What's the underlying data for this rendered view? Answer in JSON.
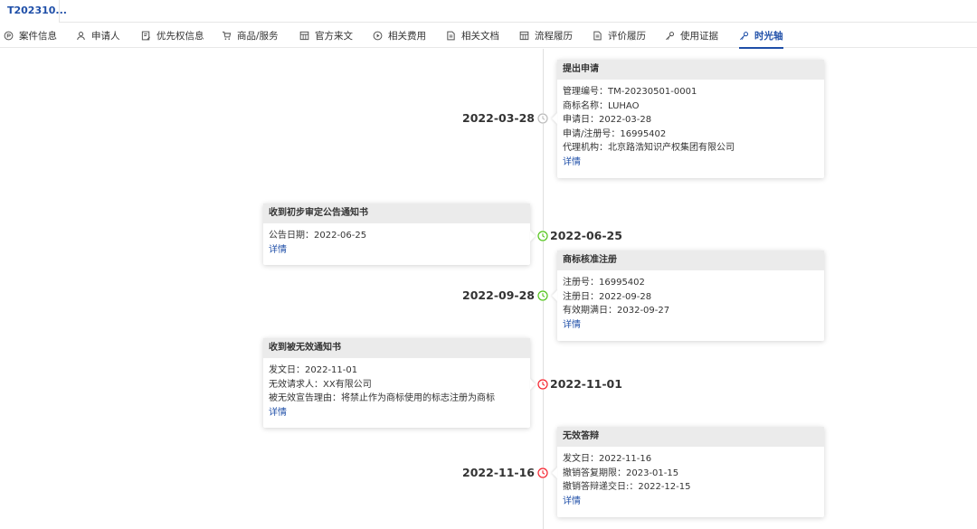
{
  "document_tab": "T202310...",
  "colors": {
    "accent": "#1f4fa8",
    "node_gray": "#bbbbbb",
    "node_green": "#52c41a",
    "node_red": "#f5222d"
  },
  "tabs": [
    {
      "label": "案件信息",
      "icon": "info-circle-icon"
    },
    {
      "label": "申请人",
      "icon": "user-icon"
    },
    {
      "label": "优先权信息",
      "icon": "document-edit-icon"
    },
    {
      "label": "商品/服务",
      "icon": "cart-icon"
    },
    {
      "label": "官方来文",
      "icon": "table-icon"
    },
    {
      "label": "相关费用",
      "icon": "play-circle-icon"
    },
    {
      "label": "相关文档",
      "icon": "file-icon"
    },
    {
      "label": "流程履历",
      "icon": "table-icon"
    },
    {
      "label": "评价履历",
      "icon": "file-icon"
    },
    {
      "label": "使用证据",
      "icon": "key-icon"
    },
    {
      "label": "时光轴",
      "icon": "key-icon",
      "active": true
    }
  ],
  "events": [
    {
      "date": "2022-03-28",
      "status": "gray",
      "side": "right",
      "title": "提出申请",
      "fields": [
        {
          "label": "管理编号",
          "value": "TM-20230501-0001"
        },
        {
          "label": "商标名称",
          "value": "LUHAO"
        },
        {
          "label": "申请日",
          "value": "2022-03-28"
        },
        {
          "label": "申请/注册号",
          "value": "16995402"
        },
        {
          "label": "代理机构",
          "value": "北京路浩知识产权集团有限公司"
        }
      ],
      "link": "详情"
    },
    {
      "date": "2022-06-25",
      "status": "green",
      "side": "left",
      "title": "收到初步审定公告通知书",
      "fields": [
        {
          "label": "公告日期",
          "value": "2022-06-25"
        }
      ],
      "link": "详情"
    },
    {
      "date": "2022-09-28",
      "status": "green",
      "side": "right",
      "title": "商标核准注册",
      "fields": [
        {
          "label": "注册号",
          "value": "16995402"
        },
        {
          "label": "注册日",
          "value": "2022-09-28"
        },
        {
          "label": "有效期满日",
          "value": "2032-09-27"
        }
      ],
      "link": "详情"
    },
    {
      "date": "2022-11-01",
      "status": "red",
      "side": "left",
      "title": "收到被无效通知书",
      "fields": [
        {
          "label": "发文日",
          "value": "2022-11-01"
        },
        {
          "label": "无效请求人",
          "value": "XX有限公司"
        },
        {
          "label": "被无效宣告理由",
          "value": "将禁止作为商标使用的标志注册为商标"
        }
      ],
      "link": "详情"
    },
    {
      "date": "2022-11-16",
      "status": "red",
      "side": "right",
      "title": "无效答辩",
      "fields": [
        {
          "label": "发文日",
          "value": "2022-11-16"
        },
        {
          "label": "撤销答复期限",
          "value": "2023-01-15"
        },
        {
          "label": "撤销答辩递交日:",
          "value": "2022-12-15"
        }
      ],
      "link": "详情"
    }
  ]
}
